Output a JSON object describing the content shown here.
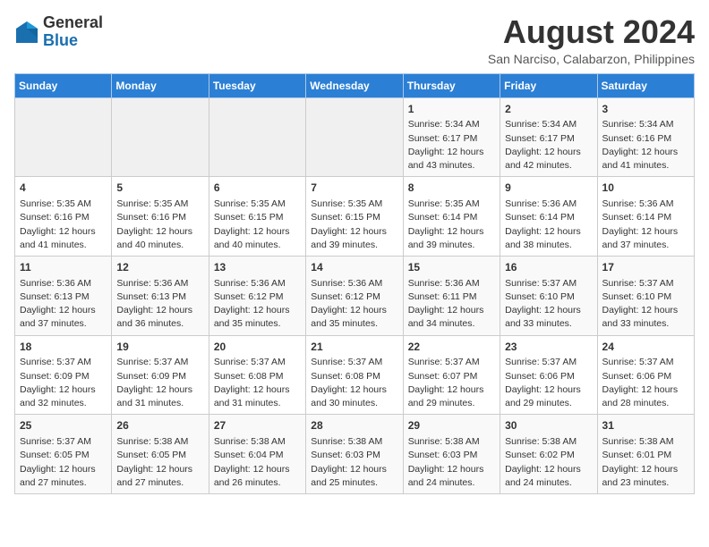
{
  "header": {
    "logo_general": "General",
    "logo_blue": "Blue",
    "month_year": "August 2024",
    "location": "San Narciso, Calabarzon, Philippines"
  },
  "calendar": {
    "days_of_week": [
      "Sunday",
      "Monday",
      "Tuesday",
      "Wednesday",
      "Thursday",
      "Friday",
      "Saturday"
    ],
    "weeks": [
      [
        {
          "day": "",
          "info": ""
        },
        {
          "day": "",
          "info": ""
        },
        {
          "day": "",
          "info": ""
        },
        {
          "day": "",
          "info": ""
        },
        {
          "day": "1",
          "info": "Sunrise: 5:34 AM\nSunset: 6:17 PM\nDaylight: 12 hours\nand 43 minutes."
        },
        {
          "day": "2",
          "info": "Sunrise: 5:34 AM\nSunset: 6:17 PM\nDaylight: 12 hours\nand 42 minutes."
        },
        {
          "day": "3",
          "info": "Sunrise: 5:34 AM\nSunset: 6:16 PM\nDaylight: 12 hours\nand 41 minutes."
        }
      ],
      [
        {
          "day": "4",
          "info": "Sunrise: 5:35 AM\nSunset: 6:16 PM\nDaylight: 12 hours\nand 41 minutes."
        },
        {
          "day": "5",
          "info": "Sunrise: 5:35 AM\nSunset: 6:16 PM\nDaylight: 12 hours\nand 40 minutes."
        },
        {
          "day": "6",
          "info": "Sunrise: 5:35 AM\nSunset: 6:15 PM\nDaylight: 12 hours\nand 40 minutes."
        },
        {
          "day": "7",
          "info": "Sunrise: 5:35 AM\nSunset: 6:15 PM\nDaylight: 12 hours\nand 39 minutes."
        },
        {
          "day": "8",
          "info": "Sunrise: 5:35 AM\nSunset: 6:14 PM\nDaylight: 12 hours\nand 39 minutes."
        },
        {
          "day": "9",
          "info": "Sunrise: 5:36 AM\nSunset: 6:14 PM\nDaylight: 12 hours\nand 38 minutes."
        },
        {
          "day": "10",
          "info": "Sunrise: 5:36 AM\nSunset: 6:14 PM\nDaylight: 12 hours\nand 37 minutes."
        }
      ],
      [
        {
          "day": "11",
          "info": "Sunrise: 5:36 AM\nSunset: 6:13 PM\nDaylight: 12 hours\nand 37 minutes."
        },
        {
          "day": "12",
          "info": "Sunrise: 5:36 AM\nSunset: 6:13 PM\nDaylight: 12 hours\nand 36 minutes."
        },
        {
          "day": "13",
          "info": "Sunrise: 5:36 AM\nSunset: 6:12 PM\nDaylight: 12 hours\nand 35 minutes."
        },
        {
          "day": "14",
          "info": "Sunrise: 5:36 AM\nSunset: 6:12 PM\nDaylight: 12 hours\nand 35 minutes."
        },
        {
          "day": "15",
          "info": "Sunrise: 5:36 AM\nSunset: 6:11 PM\nDaylight: 12 hours\nand 34 minutes."
        },
        {
          "day": "16",
          "info": "Sunrise: 5:37 AM\nSunset: 6:10 PM\nDaylight: 12 hours\nand 33 minutes."
        },
        {
          "day": "17",
          "info": "Sunrise: 5:37 AM\nSunset: 6:10 PM\nDaylight: 12 hours\nand 33 minutes."
        }
      ],
      [
        {
          "day": "18",
          "info": "Sunrise: 5:37 AM\nSunset: 6:09 PM\nDaylight: 12 hours\nand 32 minutes."
        },
        {
          "day": "19",
          "info": "Sunrise: 5:37 AM\nSunset: 6:09 PM\nDaylight: 12 hours\nand 31 minutes."
        },
        {
          "day": "20",
          "info": "Sunrise: 5:37 AM\nSunset: 6:08 PM\nDaylight: 12 hours\nand 31 minutes."
        },
        {
          "day": "21",
          "info": "Sunrise: 5:37 AM\nSunset: 6:08 PM\nDaylight: 12 hours\nand 30 minutes."
        },
        {
          "day": "22",
          "info": "Sunrise: 5:37 AM\nSunset: 6:07 PM\nDaylight: 12 hours\nand 29 minutes."
        },
        {
          "day": "23",
          "info": "Sunrise: 5:37 AM\nSunset: 6:06 PM\nDaylight: 12 hours\nand 29 minutes."
        },
        {
          "day": "24",
          "info": "Sunrise: 5:37 AM\nSunset: 6:06 PM\nDaylight: 12 hours\nand 28 minutes."
        }
      ],
      [
        {
          "day": "25",
          "info": "Sunrise: 5:37 AM\nSunset: 6:05 PM\nDaylight: 12 hours\nand 27 minutes."
        },
        {
          "day": "26",
          "info": "Sunrise: 5:38 AM\nSunset: 6:05 PM\nDaylight: 12 hours\nand 27 minutes."
        },
        {
          "day": "27",
          "info": "Sunrise: 5:38 AM\nSunset: 6:04 PM\nDaylight: 12 hours\nand 26 minutes."
        },
        {
          "day": "28",
          "info": "Sunrise: 5:38 AM\nSunset: 6:03 PM\nDaylight: 12 hours\nand 25 minutes."
        },
        {
          "day": "29",
          "info": "Sunrise: 5:38 AM\nSunset: 6:03 PM\nDaylight: 12 hours\nand 24 minutes."
        },
        {
          "day": "30",
          "info": "Sunrise: 5:38 AM\nSunset: 6:02 PM\nDaylight: 12 hours\nand 24 minutes."
        },
        {
          "day": "31",
          "info": "Sunrise: 5:38 AM\nSunset: 6:01 PM\nDaylight: 12 hours\nand 23 minutes."
        }
      ]
    ]
  }
}
